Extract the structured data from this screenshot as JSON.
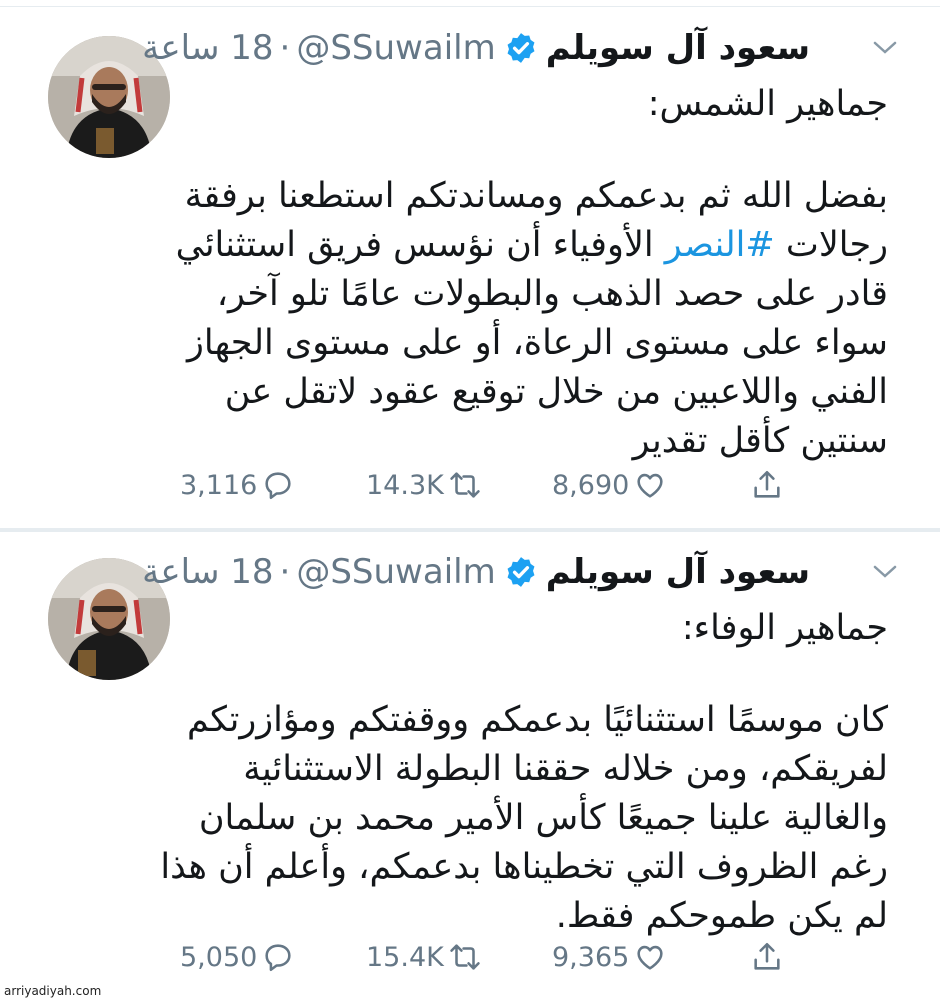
{
  "tweets": [
    {
      "display_name": "سعود آل سويلم",
      "handle": "@SSuwailm",
      "separator": "·",
      "time": "18 ساعة",
      "greeting": "جماهير الشمس:",
      "body_lines": [
        "بفضل الله ثم بدعمكم ومساندتكم استطعنا برفقة",
        "قادر على حصد الذهب والبطولات عامًا تلو آخر،",
        "سواء على مستوى الرعاة، أو على مستوى الجهاز",
        "الفني واللاعبين من خلال توقيع عقود لاتقل عن",
        "سنتين كأقل تقدير"
      ],
      "hashtag_line": {
        "before": "رجالات",
        "hashtag": "#النصر",
        "after": "الأوفياء أن نؤسس فريق استثنائي"
      },
      "replies": "3,116",
      "retweets": "14.3K",
      "likes": "8,690"
    },
    {
      "display_name": "سعود آل سويلم",
      "handle": "@SSuwailm",
      "separator": "·",
      "time": "18 ساعة",
      "greeting": "جماهير الوفاء:",
      "body_lines": [
        "كان موسمًا استثنائيًا بدعمكم ووقفتكم ومؤازرتكم",
        "لفريقكم، ومن خلاله حققنا البطولة الاستثنائية",
        "والغالية علينا جميعًا كأس الأمير محمد بن سلمان",
        "رغم الظروف التي تخطيناها بدعمكم، وأعلم أن هذا",
        "لم يكن طموحكم فقط."
      ],
      "replies": "5,050",
      "retweets": "15.4K",
      "likes": "9,365"
    }
  ],
  "watermark": "arriyadiyah.com",
  "colors": {
    "link": "#1b95e0",
    "muted": "#657786",
    "verified": "#1da1f2",
    "divider": "#e6ecf0"
  },
  "icons": [
    "chevron-down-icon",
    "verified-badge-icon",
    "reply-icon",
    "retweet-icon",
    "like-icon",
    "share-icon"
  ]
}
